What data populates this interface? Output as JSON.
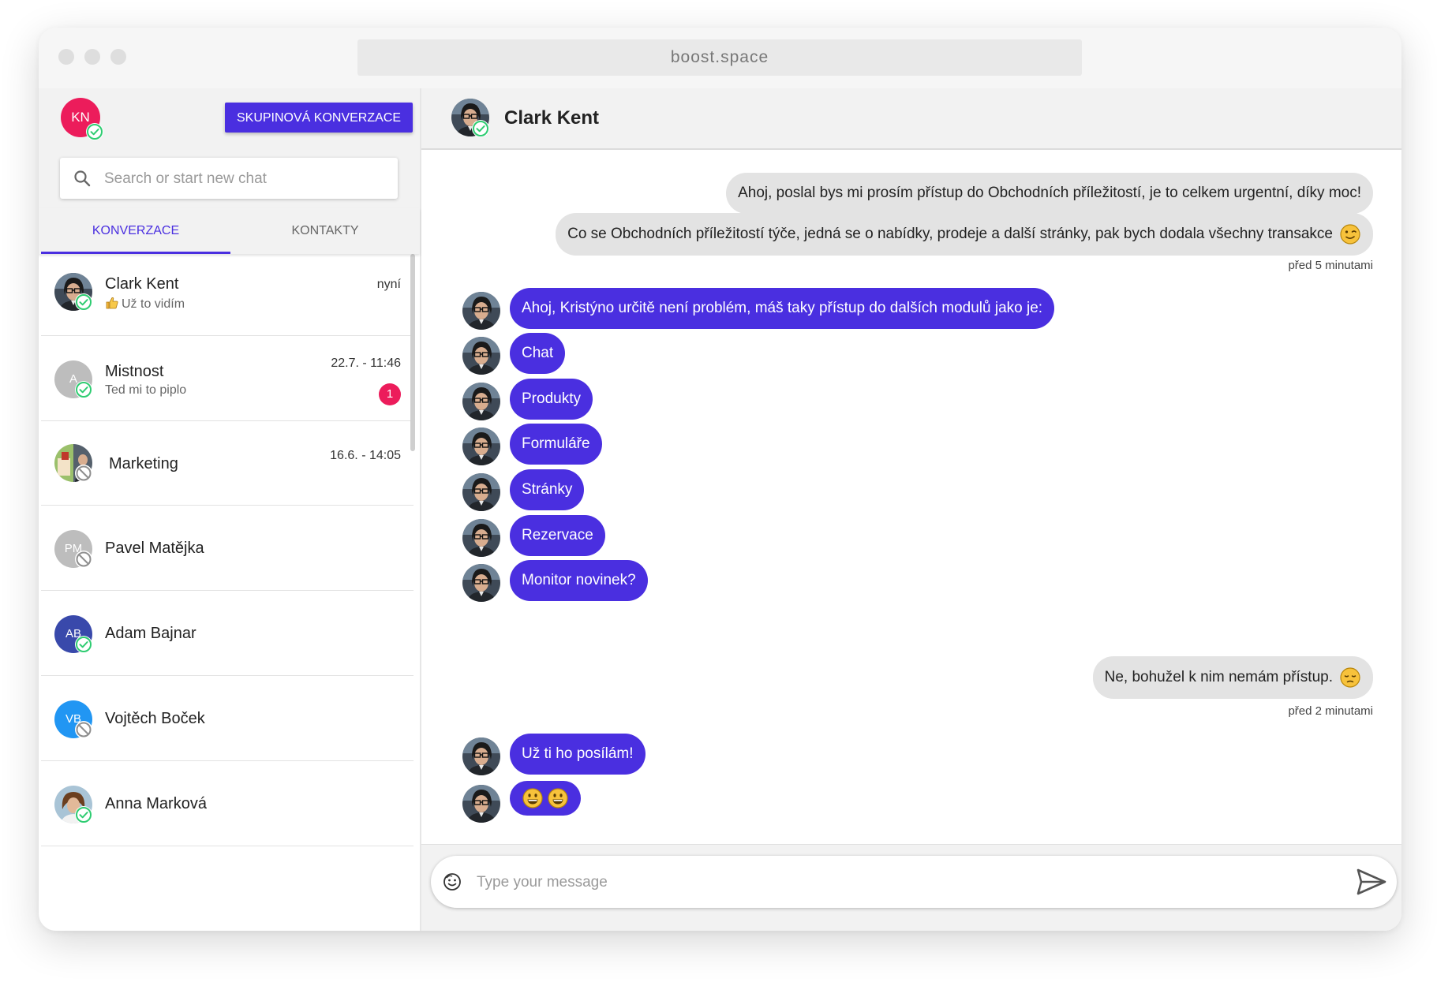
{
  "browser": {
    "url": "boost.space"
  },
  "sidebar": {
    "me": {
      "initials": "KN"
    },
    "group_button_label": "SKUPINOVÁ KONVERZACE",
    "search": {
      "placeholder": "Search or start new chat"
    },
    "tabs": [
      {
        "label": "KONVERZACE",
        "active": true
      },
      {
        "label": "KONTAKTY",
        "active": false
      }
    ],
    "conversations": [
      {
        "name": "Clark Kent",
        "last_message": "Už to vidím",
        "time": "nyní",
        "status": "online"
      },
      {
        "name": "Mistnost",
        "initials": "A",
        "last_message": "Ted mi to piplo",
        "time": "22.7. - 11:46",
        "unread": "1",
        "status": "online"
      },
      {
        "name": "Marketing",
        "time": "16.6. - 14:05",
        "status": "offline"
      },
      {
        "name": "Pavel Matějka",
        "initials": "PM",
        "status": "offline"
      },
      {
        "name": "Adam Bajnar",
        "initials": "AB",
        "status": "online"
      },
      {
        "name": "Vojtěch Boček",
        "initials": "VB",
        "status": "offline"
      },
      {
        "name": "Anna Marková",
        "status": "online"
      }
    ]
  },
  "chat": {
    "contact_name": "Clark Kent",
    "messages": [
      {
        "direction": "out",
        "text": "Ahoj, poslal bys mi prosím přístup do Obchodních příležitostí, je to celkem urgentní, díky moc!"
      },
      {
        "direction": "out",
        "text": "Co se Obchodních příležitostí týče, jedná se o nabídky, prodeje a další stránky, pak bych dodala všechny transakce",
        "emoji": "wink"
      },
      {
        "direction": "in",
        "text": "Ahoj, Kristýno určitě není problém, máš taky přístup do dalších modulů jako je:"
      },
      {
        "direction": "in",
        "text": "Chat"
      },
      {
        "direction": "in",
        "text": "Produkty"
      },
      {
        "direction": "in",
        "text": "Formuláře"
      },
      {
        "direction": "in",
        "text": "Stránky"
      },
      {
        "direction": "in",
        "text": "Rezervace"
      },
      {
        "direction": "in",
        "text": "Monitor novinek?"
      },
      {
        "direction": "out",
        "text": "Ne, bohužel k nim nemám přístup.",
        "emoji": "sad"
      },
      {
        "direction": "in",
        "text": "Už ti ho posílám!"
      },
      {
        "direction": "in",
        "emoji": "grin-grin"
      }
    ],
    "timestamps": [
      "před 5 minutami",
      "před 2 minutami"
    ],
    "composer": {
      "placeholder": "Type your message"
    }
  },
  "colors": {
    "accent": "#4a2fe0",
    "badge": "#ec1c5b",
    "online": "#2ecc71",
    "offline": "#9e9e9e"
  },
  "icons": [
    "search-icon",
    "online-status-icon",
    "offline-status-icon",
    "thumbs-up-icon",
    "emoji-wink-icon",
    "emoji-sad-icon",
    "emoji-grin-icon",
    "smiley-icon",
    "send-icon"
  ]
}
